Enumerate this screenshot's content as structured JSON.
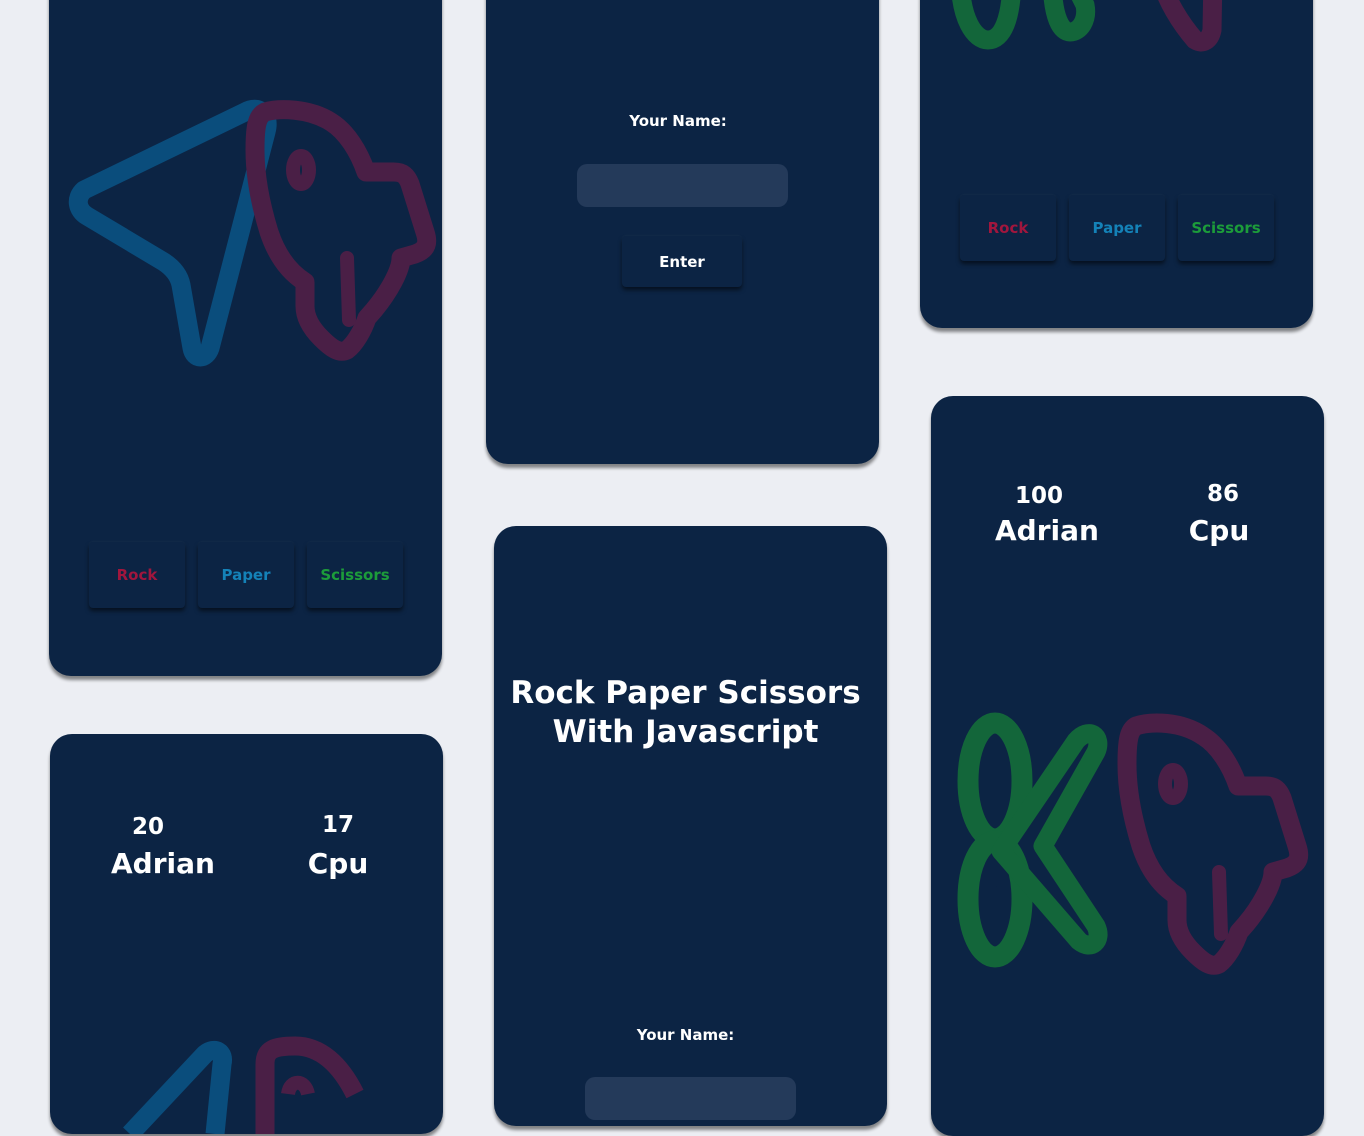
{
  "colors": {
    "page_bg": "#eceef3",
    "card_bg": "#0c2444",
    "rock": "#a1163d",
    "paper": "#1482b8",
    "scissors": "#1c9c3a",
    "icon_paper": "#0a4d7c",
    "icon_rock": "#4a1f46",
    "icon_scissors": "#13663a"
  },
  "icons": {
    "paper": "navigation-arrow-icon",
    "rock": "rocket-icon",
    "scissors": "scissors-icon"
  },
  "choices": {
    "rock": "Rock",
    "paper": "Paper",
    "scissors": "Scissors"
  },
  "login": {
    "label": "Your Name:",
    "input_value": "",
    "enter_label": "Enter"
  },
  "intro": {
    "title_line1": "Rock Paper Scissors",
    "title_line2": "With Javascript",
    "label": "Your Name:"
  },
  "score_small": {
    "player_score": "20",
    "player_name": "Adrian",
    "cpu_score": "17",
    "cpu_name": "Cpu"
  },
  "score_large": {
    "player_score": "100",
    "player_name": "Adrian",
    "cpu_score": "86",
    "cpu_name": "Cpu"
  }
}
